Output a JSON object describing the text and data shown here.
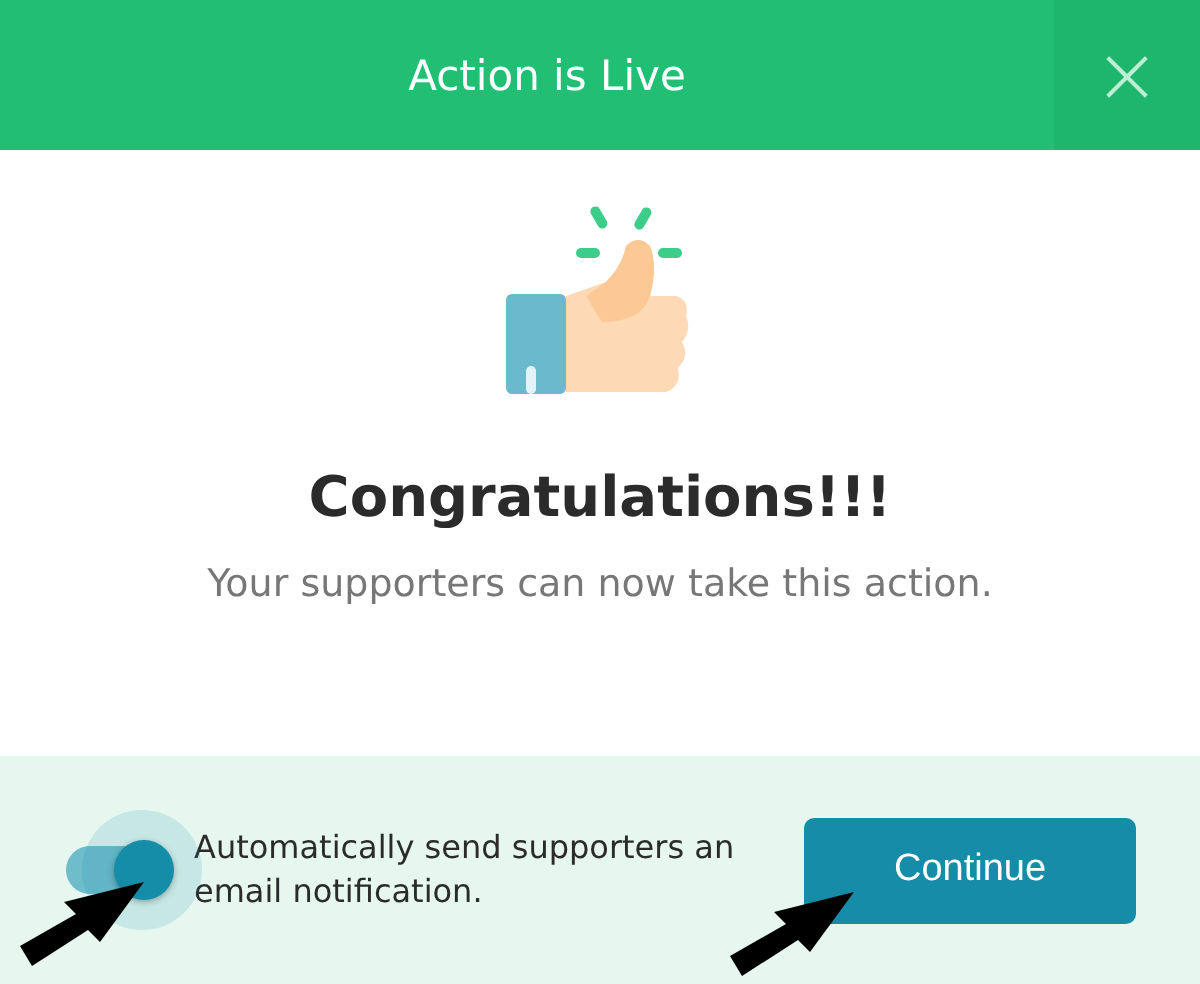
{
  "dialog": {
    "title": "Action is Live",
    "close": "×"
  },
  "heading": "Congratulations!!!",
  "message": "Your supporters can now take this action.",
  "notify_toggle": {
    "on": true,
    "label": "Automatically send supporters an email notification."
  },
  "buttons": [
    "Continue"
  ]
}
